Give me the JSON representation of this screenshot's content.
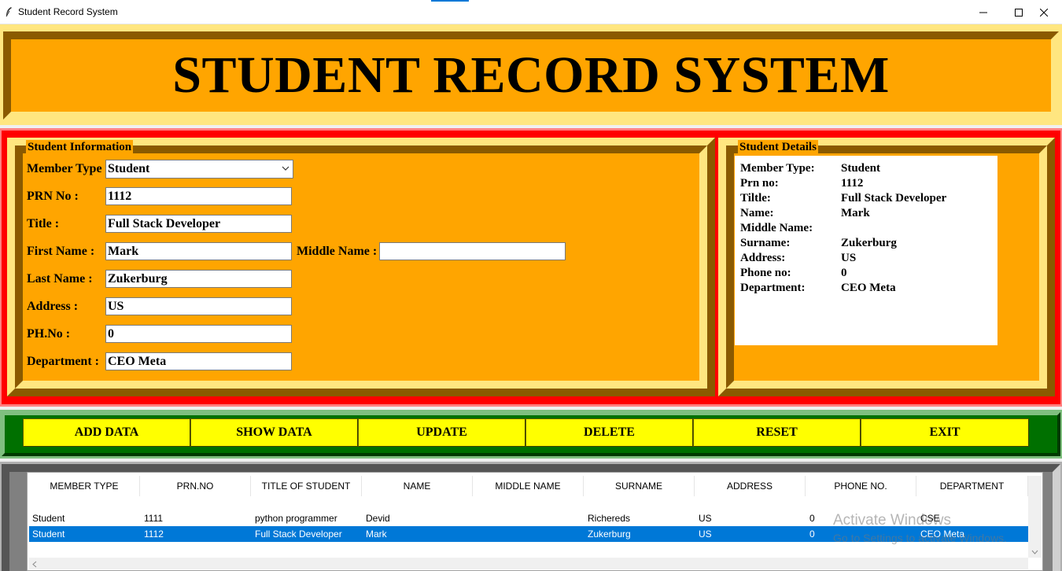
{
  "window": {
    "title": "Student Record System",
    "icons": {
      "app": "feather-icon",
      "minimize": "minimize-icon",
      "maximize": "maximize-icon",
      "close": "close-icon"
    }
  },
  "header": {
    "title": "STUDENT RECORD SYSTEM"
  },
  "student_information": {
    "group_label": "Student Information",
    "member_type": {
      "label": "Member Type",
      "value": "Student"
    },
    "prn": {
      "label": "PRN No :",
      "value": "1112"
    },
    "title": {
      "label": "Title :",
      "value": "Full Stack Developer"
    },
    "first_name": {
      "label": "First Name :",
      "value": "Mark"
    },
    "middle_name": {
      "label": "Middle Name :",
      "value": ""
    },
    "last_name": {
      "label": "Last Name :",
      "value": "Zukerburg"
    },
    "address": {
      "label": "Address :",
      "value": "US"
    },
    "phone": {
      "label": "PH.No :",
      "value": "0"
    },
    "department": {
      "label": "Department :",
      "value": "CEO Meta"
    }
  },
  "student_details": {
    "group_label": "Student Details",
    "rows": [
      {
        "label": "Member Type:",
        "value": "Student"
      },
      {
        "label": "Prn no:",
        "value": "1112"
      },
      {
        "label": "Tiltle:",
        "value": "Full Stack Developer"
      },
      {
        "label": "Name:",
        "value": "Mark"
      },
      {
        "label": "Middle Name:",
        "value": ""
      },
      {
        "label": "Surname:",
        "value": "Zukerburg"
      },
      {
        "label": "Address:",
        "value": "US"
      },
      {
        "label": "Phone no:",
        "value": "0"
      },
      {
        "label": "Department:",
        "value": "CEO Meta"
      }
    ]
  },
  "buttons": {
    "add": "ADD DATA",
    "show": "SHOW DATA",
    "update": "UPDATE",
    "delete": "DELETE",
    "reset": "RESET",
    "exit": "EXIT"
  },
  "table": {
    "columns": [
      "MEMBER TYPE",
      "PRN.NO",
      "TITLE OF STUDENT",
      "NAME",
      "MIDDLE NAME",
      "SURNAME",
      "ADDRESS",
      "PHONE NO.",
      "DEPARTMENT"
    ],
    "rows": [
      {
        "cells": [
          "Student",
          "1111",
          "python programmer",
          "Devid",
          "",
          "Richereds",
          "US",
          "0",
          "CSE"
        ],
        "selected": false
      },
      {
        "cells": [
          "Student",
          "1112",
          "Full Stack Developer",
          "Mark",
          "",
          "Zukerburg",
          "US",
          "0",
          "CEO Meta"
        ],
        "selected": true
      }
    ]
  },
  "watermark": {
    "line1": "Activate Windows",
    "line2": "Go to Settings to activate Windows."
  },
  "colors": {
    "banner": "#ffa500",
    "button": "#ffff00",
    "selected_row": "#0078d7",
    "data_frame": "#ff0000",
    "button_frame": "#007000"
  }
}
